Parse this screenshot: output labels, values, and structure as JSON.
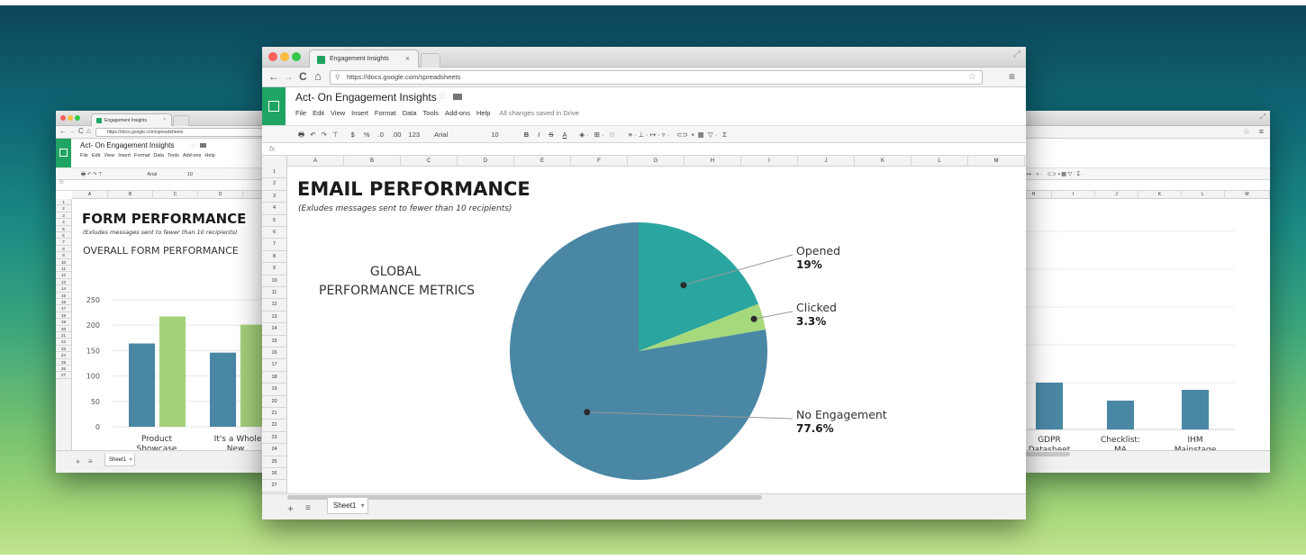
{
  "left_window": {
    "tab_title": "Engagement Insights",
    "url": "https://docs.google.com/spreadsheets",
    "doc_title": "Act- On Engagement Insights",
    "menu": [
      "File",
      "Edit",
      "View",
      "Insert",
      "Format",
      "Data",
      "Tools",
      "Add-ons",
      "Help"
    ],
    "toolbar_font": "Arial",
    "toolbar_size": "10",
    "fx": "fx",
    "columns": [
      "A",
      "B",
      "C",
      "D"
    ],
    "rows": [
      "1",
      "2",
      "3",
      "4",
      "5",
      "6",
      "7",
      "8",
      "9",
      "10",
      "11",
      "12",
      "13",
      "14",
      "15",
      "16",
      "17",
      "18",
      "19",
      "20",
      "21",
      "22",
      "23",
      "24",
      "25",
      "26",
      "27"
    ],
    "sheet_tab": "Sheet1",
    "heading": "FORM PERFORMANCE",
    "subtitle": "(Exludes messages sent to fewer than 10 recipients)",
    "chart_title": "OVERALL FORM PERFORMANCE"
  },
  "center_window": {
    "tab_title": "Engagement Insights",
    "url": "https://docs.google.com/spreadsheets",
    "doc_title": "Act- On Engagement Insights",
    "menu": [
      "File",
      "Edit",
      "View",
      "Insert",
      "Format",
      "Data",
      "Tools",
      "Add-ons",
      "Help"
    ],
    "save_status": "All changes saved in Drive",
    "toolbar": {
      "currency": "$",
      "percent": "%",
      "dec_less": ".0",
      "dec_more": ".00",
      "number_format": "123",
      "font": "Arial",
      "size": "10",
      "bold": "B",
      "italic": "I",
      "strike": "S",
      "text_color": "A",
      "sum": "Σ"
    },
    "fx": "fx",
    "columns": [
      "A",
      "B",
      "C",
      "D",
      "E",
      "F",
      "G",
      "H",
      "I",
      "J",
      "K",
      "L",
      "M"
    ],
    "rows": [
      "1",
      "2",
      "3",
      "4",
      "5",
      "6",
      "7",
      "8",
      "9",
      "10",
      "11",
      "12",
      "13",
      "14",
      "15",
      "16",
      "17",
      "18",
      "19",
      "20",
      "21",
      "22",
      "23",
      "24",
      "25",
      "26",
      "27"
    ],
    "sheet_tab": "Sheet1",
    "heading": "EMAIL PERFORMANCE",
    "subtitle": "(Exludes messages sent to fewer than 10 recipients)",
    "chart_label_line1": "GLOBAL",
    "chart_label_line2": "PERFORMANCE METRICS"
  },
  "right_window": {
    "columns": [
      "H",
      "I",
      "J",
      "K",
      "L",
      "M"
    ]
  },
  "chart_data": [
    {
      "type": "bar",
      "categories": [
        "Product Showcase",
        "It's a Whole New.."
      ],
      "category_lines": [
        [
          "Product",
          "Showcase"
        ],
        [
          "It's a Whole",
          "New.."
        ]
      ],
      "series": [
        {
          "color": "#4a87a5",
          "values": [
            164,
            146
          ]
        },
        {
          "color": "#a4d07a",
          "values": [
            217,
            201
          ]
        }
      ],
      "ylim": [
        0,
        250
      ],
      "yticks": [
        "250",
        "200",
        "150",
        "100",
        "50",
        "0"
      ],
      "grid": true
    },
    {
      "type": "pie",
      "slices": [
        {
          "label": "Opened",
          "value": 19,
          "display": "19%",
          "color": "#2aa59f"
        },
        {
          "label": "Clicked",
          "value": 3.3,
          "display": "3.3%",
          "color": "#a6d97c"
        },
        {
          "label": "No Engagement",
          "value": 77.6,
          "display": "77.6%",
          "color": "#4a87a5"
        }
      ]
    },
    {
      "type": "bar",
      "categories": [
        "GDPR Datasheet",
        "Checklist: MA",
        "IHM Mainstage"
      ],
      "category_lines": [
        [
          "GDPR",
          "Datasheet"
        ],
        [
          "Checklist:",
          "MA"
        ],
        [
          "IHM",
          "Mainstage"
        ]
      ],
      "series": [
        {
          "color": "#4a87a5",
          "values": [
            null,
            null,
            null
          ]
        }
      ],
      "grid": true
    }
  ],
  "colors": {
    "accent": "#1fa463",
    "pie_blue": "#4a87a5",
    "pie_teal": "#2aa59f",
    "pie_green": "#a6d97c"
  }
}
